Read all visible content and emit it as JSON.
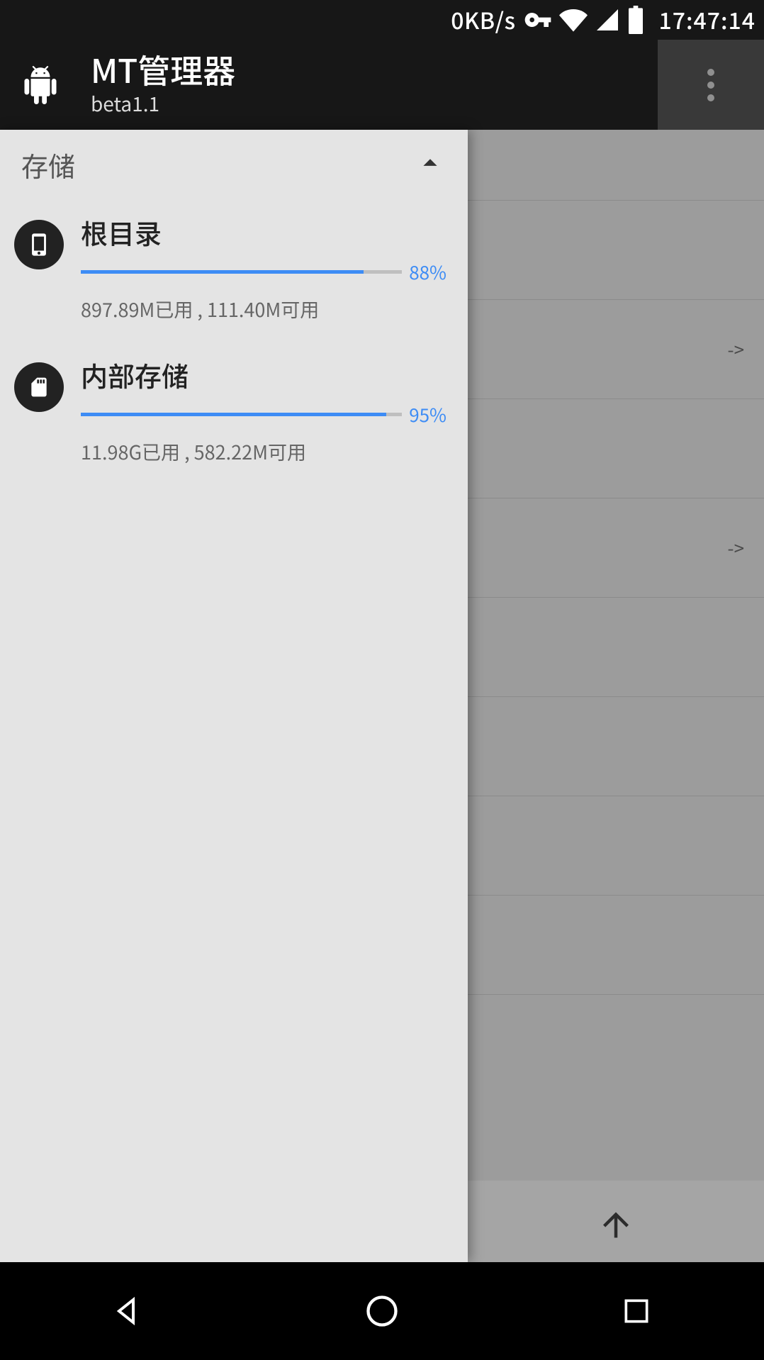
{
  "status": {
    "speed": "0KB/s",
    "clock": "17:47:14"
  },
  "app": {
    "title": "MT管理器",
    "subtitle": "beta1.1"
  },
  "drawer": {
    "section_label": "存储",
    "items": [
      {
        "name": "根目录",
        "percent_label": "88%",
        "percent": 88,
        "detail": "897.89M已用 , 111.40M可用"
      },
      {
        "name": "内部存储",
        "percent_label": "95%",
        "percent": 95,
        "detail": "11.98G已用 , 582.22M可用"
      }
    ]
  },
  "bg": {
    "arrow1": "->",
    "arrow2": "->"
  }
}
